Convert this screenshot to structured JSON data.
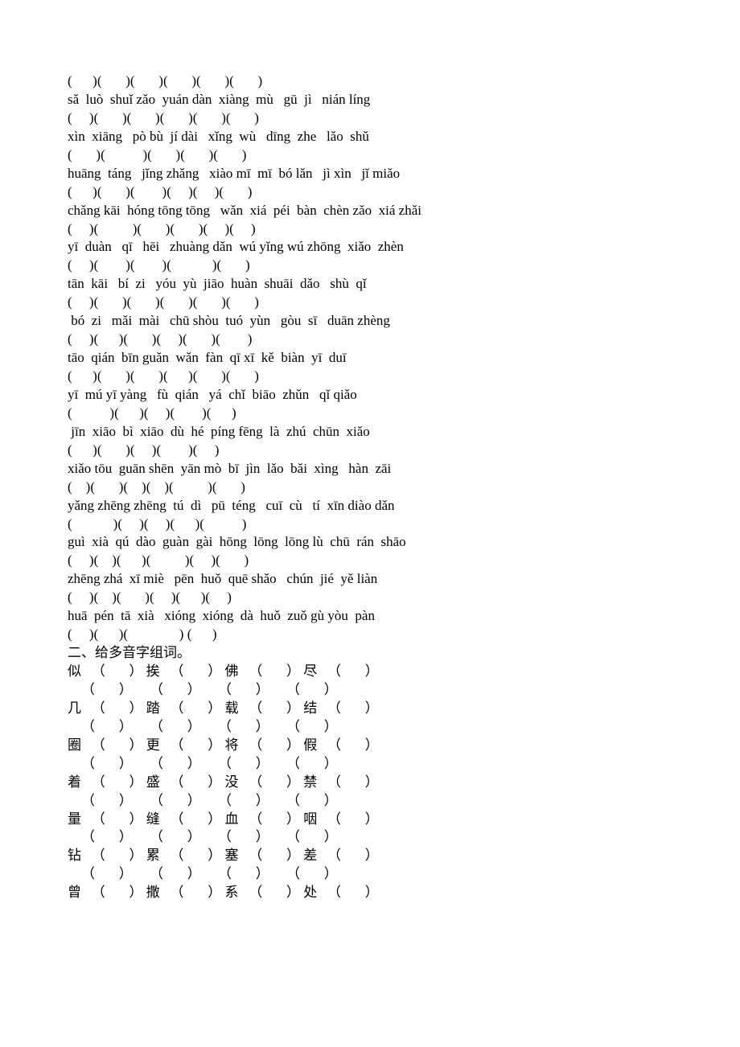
{
  "pinyin_rows": [
    "(      )(       )(       )(       )(       )(       )",
    "sǎ  luò  shuǐ zǎo  yuán dàn  xiàng  mù   gū  jì   nián líng",
    "(     )(       )(       )(       )(       )(       )",
    "xìn  xiāng   pò bù  jí dài   xǐng  wù   dīng  zhe   lǎo  shǔ",
    "(       )(           )(       )(       )(       )",
    "huāng  táng   jǐng zhǎng   xiào mī  mī  bó lǎn   jì xìn   jǐ miǎo",
    "(      )(       )(        )(     )(     )(       )",
    "chǎng kāi  hóng tōng tōng   wǎn  xiá  péi  bàn  chèn zǎo  xiá zhǎi",
    "(     )(          )(       )(       )(     )(     )",
    "yī  duàn   qī   hēi   zhuàng dǎn  wú yǐng wú zhōng  xiǎo  zhèn",
    "(     )(        )(        )(            )(       )",
    "tān  kāi   bí  zi   yóu  yù  jiāo  huàn  shuāi  dǎo   shù  qǐ",
    "(     )(       )(       )(       )(       )(       )",
    " bó  zi   mǎi  mài   chū shòu  tuó  yùn   gòu  sī   duān zhèng",
    "(     )(      )(       )(     )(       )(        )",
    "tāo  qián  bīn guǎn  wǎn  fàn  qī xī  kě  biàn  yī  duī",
    "(      )(       )(       )(      )(       )(       )",
    "yī  mú yī yàng   fù  qián   yá  chǐ  biāo  zhǔn   qǐ qiǎo",
    "(           )(      )(     )(        )(      )",
    " jīn  xiāo  bì  xiāo  dù  hé  píng fēng  là  zhú  chūn  xiǎo",
    "(      )(       )(     )(        )(     )",
    "xiǎo tōu  guān shēn  yān mò  bī  jìn  lǎo  bǎi  xìng   hàn  zāi",
    "(    )(       )(    )(    )(          )(       )",
    "yǎng zhēng zhēng  tú  dì   pū  téng   cuī  cù   tí  xīn diào dǎn",
    "(            )(     )(     )(      )(           )",
    "guì  xià  qú  dào  guàn  gài  hōng  lōng  lōng lù  chū  rán  shāo",
    "(     )(    )(      )(          )(     )(       )",
    "zhēng zhá  xī miè   pēn  huǒ  quē shǎo   chún  jié  yě liàn",
    "(     )(    )(       )(     )(      )(     )",
    "huā  pén  tā  xià   xióng  xióng  dà  huǒ  zuǒ gù yòu  pàn",
    "(     )(      )(               ) (      )"
  ],
  "section2_title": "二、给多音字组词。",
  "polyphone_rows": [
    [
      "似",
      "挨",
      "佛",
      "尽"
    ],
    [
      "几",
      "踏",
      "载",
      "结"
    ],
    [
      "圈",
      "更",
      "将",
      "假"
    ],
    [
      "着",
      "盛",
      "没",
      "禁"
    ],
    [
      "量",
      "缝",
      "血",
      "咽"
    ],
    [
      "钻",
      "累",
      "塞",
      "差"
    ]
  ],
  "polyphone_last": [
    "曾",
    "撒",
    "系",
    "处"
  ]
}
